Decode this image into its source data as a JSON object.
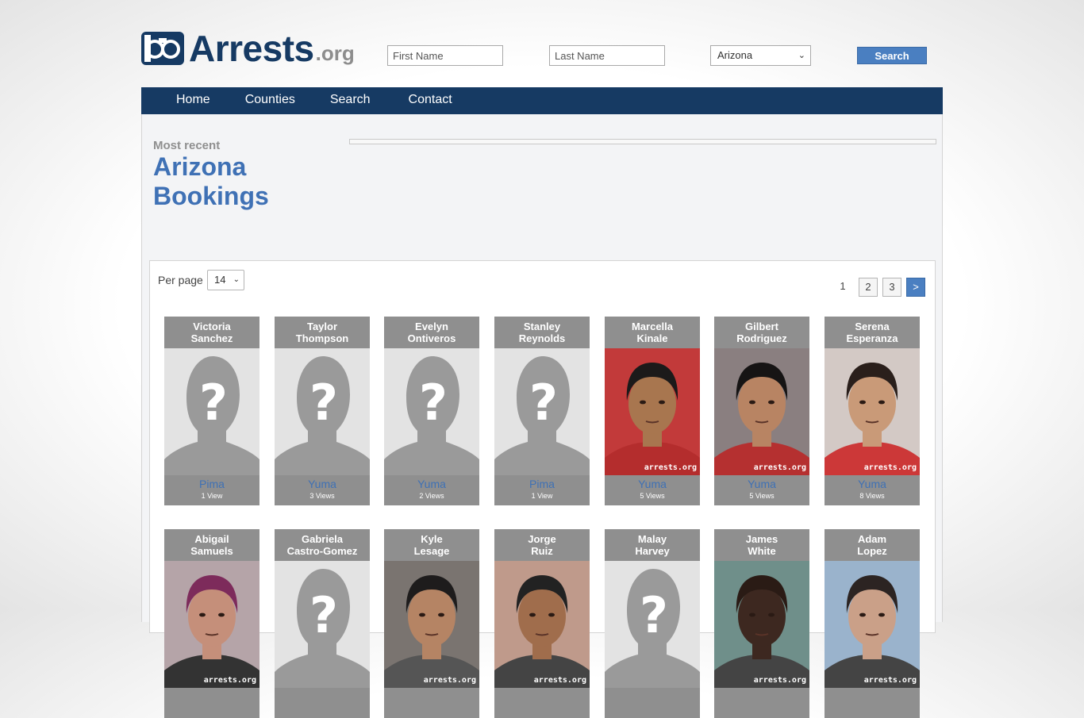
{
  "logo": {
    "name": "Arrests",
    "tld": ".org"
  },
  "search": {
    "first_placeholder": "First Name",
    "last_placeholder": "Last Name",
    "state": "Arizona",
    "button": "Search"
  },
  "nav": [
    "Home",
    "Counties",
    "Search",
    "Contact"
  ],
  "heading": {
    "eyebrow": "Most recent",
    "line1": "Arizona",
    "line2": "Bookings"
  },
  "listing": {
    "per_page_label": "Per page",
    "per_page_value": "14",
    "pages": [
      "1",
      "2",
      "3"
    ],
    "next": ">"
  },
  "watermark": "arrests.org",
  "bookings": [
    {
      "first": "Victoria",
      "last": "Sanchez",
      "county": "Pima",
      "views": "1 View",
      "photo": "placeholder"
    },
    {
      "first": "Taylor",
      "last": "Thompson",
      "county": "Yuma",
      "views": "3 Views",
      "photo": "placeholder"
    },
    {
      "first": "Evelyn",
      "last": "Ontiveros",
      "county": "Yuma",
      "views": "2 Views",
      "photo": "placeholder"
    },
    {
      "first": "Stanley",
      "last": "Reynolds",
      "county": "Pima",
      "views": "1 View",
      "photo": "placeholder"
    },
    {
      "first": "Marcella",
      "last": "Kinale",
      "county": "Yuma",
      "views": "5 Views",
      "photo": "mugshot",
      "bg": "#c23a3a",
      "skin": "#a8764f",
      "hair": "#1c1a1a",
      "shirt": "#b42d2d"
    },
    {
      "first": "Gilbert",
      "last": "Rodriguez",
      "county": "Yuma",
      "views": "5 Views",
      "photo": "mugshot",
      "bg": "#8a7f80",
      "skin": "#b88463",
      "hair": "#161414",
      "shirt": "#b53030"
    },
    {
      "first": "Serena",
      "last": "Esperanza",
      "county": "Yuma",
      "views": "8 Views",
      "photo": "mugshot",
      "bg": "#d3c9c5",
      "skin": "#c99a78",
      "hair": "#2a1f1b",
      "shirt": "#cc3838"
    },
    {
      "first": "Abigail",
      "last": "Samuels",
      "photo": "mugshot",
      "bg": "#b5a4a8",
      "skin": "#c58f7a",
      "hair": "#7d2b5b",
      "shirt": "#333"
    },
    {
      "first": "Gabriela",
      "last": "Castro-Gomez",
      "photo": "placeholder"
    },
    {
      "first": "Kyle",
      "last": "Lesage",
      "photo": "mugshot",
      "bg": "#7a7470",
      "skin": "#b58464",
      "hair": "#1e1c1c",
      "shirt": "#555"
    },
    {
      "first": "Jorge",
      "last": "Ruiz",
      "photo": "mugshot",
      "bg": "#bf9a8b",
      "skin": "#a06d4c",
      "hair": "#222",
      "shirt": "#444"
    },
    {
      "first": "Malay",
      "last": "Harvey",
      "photo": "placeholder"
    },
    {
      "first": "James",
      "last": "White",
      "photo": "mugshot",
      "bg": "#6f8f8a",
      "skin": "#3d2820",
      "hair": "#2a1b15",
      "shirt": "#444"
    },
    {
      "first": "Adam",
      "last": "Lopez",
      "photo": "mugshot",
      "bg": "#9ab3cc",
      "skin": "#caa088",
      "hair": "#2c2422",
      "shirt": "#444"
    }
  ]
}
